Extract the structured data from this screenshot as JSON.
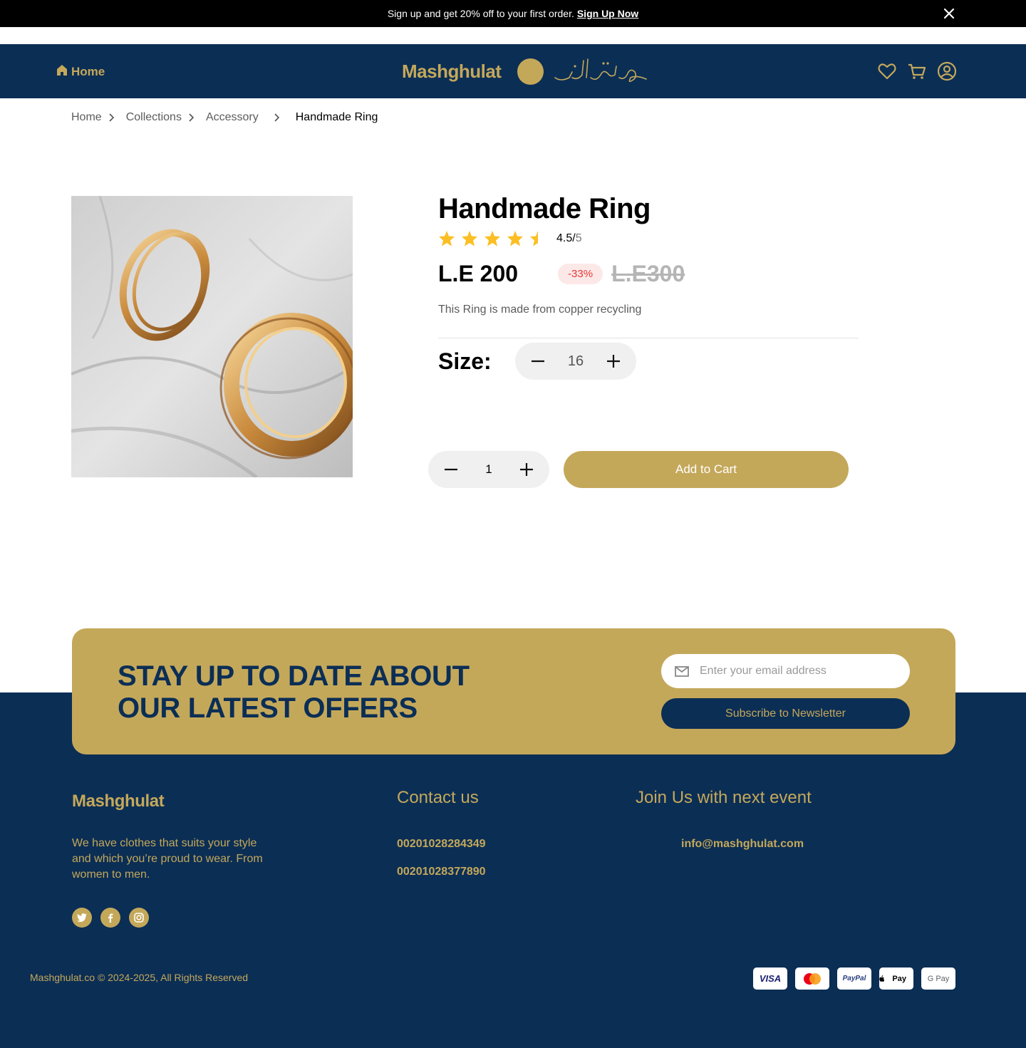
{
  "announcement": {
    "text": "Sign up and get 20% off to your first order.",
    "link": "Sign Up Now"
  },
  "header": {
    "home_label": "Home",
    "brand_latin": "Mashghulat",
    "brand_arabic": "مشغولات",
    "icons": [
      "heart-icon",
      "cart-icon",
      "user-icon"
    ]
  },
  "breadcrumb": [
    "Home",
    "Collections",
    "Accessory",
    "Handmade Ring"
  ],
  "product": {
    "title": "Handmade Ring",
    "rating": 4.5,
    "rating_value": "4.5/",
    "rating_max": "5",
    "price": "L.E 200",
    "discount": "-33%",
    "old_price": "L.E300",
    "description": "This Ring is made from copper recycling",
    "size_label": "Size:",
    "size_value": "16",
    "quantity": "1",
    "add_to_cart": "Add to Cart"
  },
  "newsletter": {
    "heading_line1": "STAY UP TO DATE ABOUT",
    "heading_line2": "OUR LATEST OFFERS",
    "email_placeholder": "Enter your email address",
    "subscribe_label": "Subscribe to Newsletter"
  },
  "footer": {
    "brand": "Mashghulat",
    "about": "We have clothes that suits your style and which you’re proud to wear. From women to men.",
    "contact_heading": "Contact us",
    "phones": [
      "00201028284349",
      "00201028377890"
    ],
    "event_heading": "Join Us with next event",
    "email": "info@mashghulat.com",
    "copyright": "Mashghulat.co © 2024-2025, All Rights Reserved",
    "socials": [
      "twitter-icon",
      "facebook-icon",
      "instagram-icon"
    ],
    "payments": [
      "VISA",
      "mastercard",
      "PayPal",
      "Pay",
      "G Pay"
    ]
  },
  "colors": {
    "navy": "#0b2e55",
    "gold": "#c4a85a",
    "discount_bg": "#fde8e8",
    "discount_text": "#e53935"
  }
}
